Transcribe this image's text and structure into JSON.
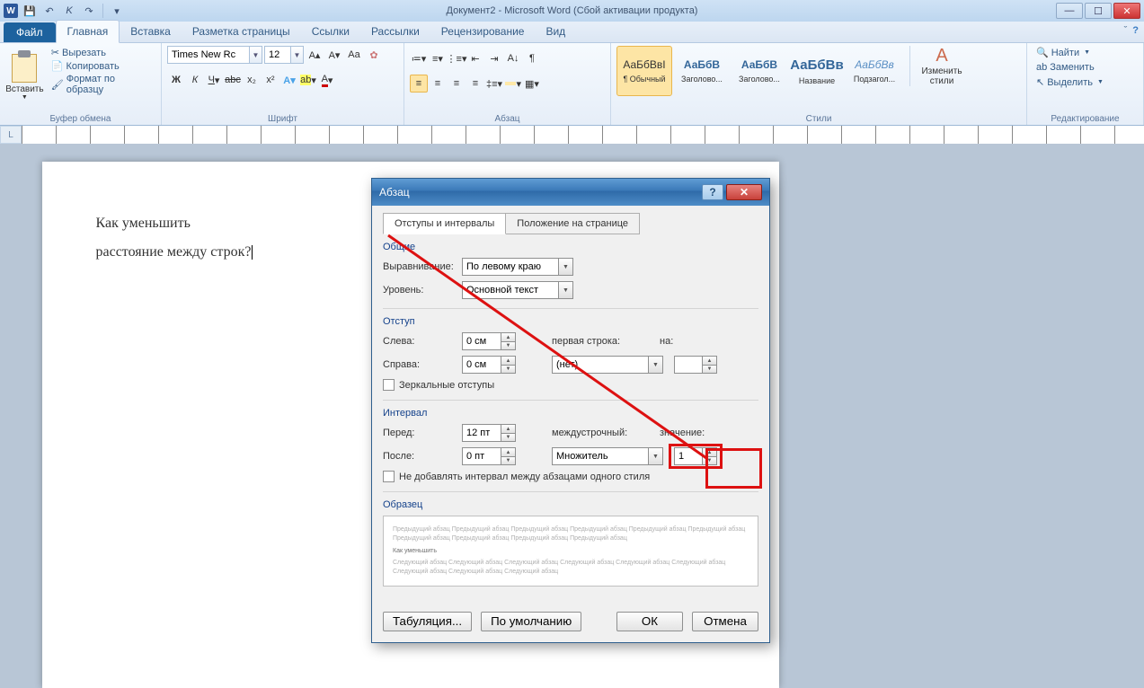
{
  "titlebar": {
    "title": "Документ2 - Microsoft Word (Сбой активации продукта)"
  },
  "tabs": {
    "file": "Файл",
    "items": [
      "Главная",
      "Вставка",
      "Разметка страницы",
      "Ссылки",
      "Рассылки",
      "Рецензирование",
      "Вид"
    ],
    "active": 0
  },
  "ribbon": {
    "clipboard": {
      "group": "Буфер обмена",
      "paste": "Вставить",
      "cut": "Вырезать",
      "copy": "Копировать",
      "format_painter": "Формат по образцу"
    },
    "font": {
      "group": "Шрифт",
      "name": "Times New Rc",
      "size": "12"
    },
    "paragraph": {
      "group": "Абзац"
    },
    "styles": {
      "group": "Стили",
      "items": [
        {
          "sample": "АаБбВвI",
          "label": "¶ Обычный",
          "sel": true,
          "color": "#333"
        },
        {
          "sample": "АаБбВ",
          "label": "Заголово...",
          "sel": false,
          "color": "#336699",
          "bold": true
        },
        {
          "sample": "АаБбВ",
          "label": "Заголово...",
          "sel": false,
          "color": "#336699",
          "bold": true
        },
        {
          "sample": "АаБбВв",
          "label": "Название",
          "sel": false,
          "color": "#336699",
          "bold": true,
          "big": true
        },
        {
          "sample": "АаБбВв",
          "label": "Подзагол...",
          "sel": false,
          "color": "#5a8fc4",
          "italic": true
        }
      ],
      "change": "Изменить стили"
    },
    "editing": {
      "group": "Редактирование",
      "find": "Найти",
      "replace": "Заменить",
      "select": "Выделить"
    }
  },
  "document": {
    "line1": "Как уменьшить",
    "line2": "расстояние между строк?"
  },
  "dialog": {
    "title": "Абзац",
    "tab1": "Отступы и интервалы",
    "tab2": "Положение на странице",
    "general": {
      "title": "Общие",
      "align_label": "Выравнивание:",
      "align_value": "По левому краю",
      "level_label": "Уровень:",
      "level_value": "Основной текст"
    },
    "indent": {
      "title": "Отступ",
      "left_label": "Слева:",
      "left_value": "0 см",
      "right_label": "Справа:",
      "right_value": "0 см",
      "first_label": "первая строка:",
      "first_value": "(нет)",
      "by_label": "на:",
      "by_value": "",
      "mirror": "Зеркальные отступы"
    },
    "spacing": {
      "title": "Интервал",
      "before_label": "Перед:",
      "before_value": "12 пт",
      "after_label": "После:",
      "after_value": "0 пт",
      "line_label": "междустрочный:",
      "line_value": "Множитель",
      "at_label": "значение:",
      "at_value": "1",
      "nosame": "Не добавлять интервал между абзацами одного стиля"
    },
    "preview": {
      "title": "Образец",
      "prev": "Предыдущий абзац Предыдущий абзац Предыдущий абзац Предыдущий абзац Предыдущий абзац Предыдущий абзац Предыдущий абзац Предыдущий абзац Предыдущий абзац Предыдущий абзац",
      "cur": "Как уменьшить",
      "next": "Следующий абзац Следующий абзац Следующий абзац Следующий абзац Следующий абзац Следующий абзац Следующий абзац Следующий абзац Следующий абзац"
    },
    "buttons": {
      "tabs": "Табуляция...",
      "default": "По умолчанию",
      "ok": "ОК",
      "cancel": "Отмена"
    }
  }
}
